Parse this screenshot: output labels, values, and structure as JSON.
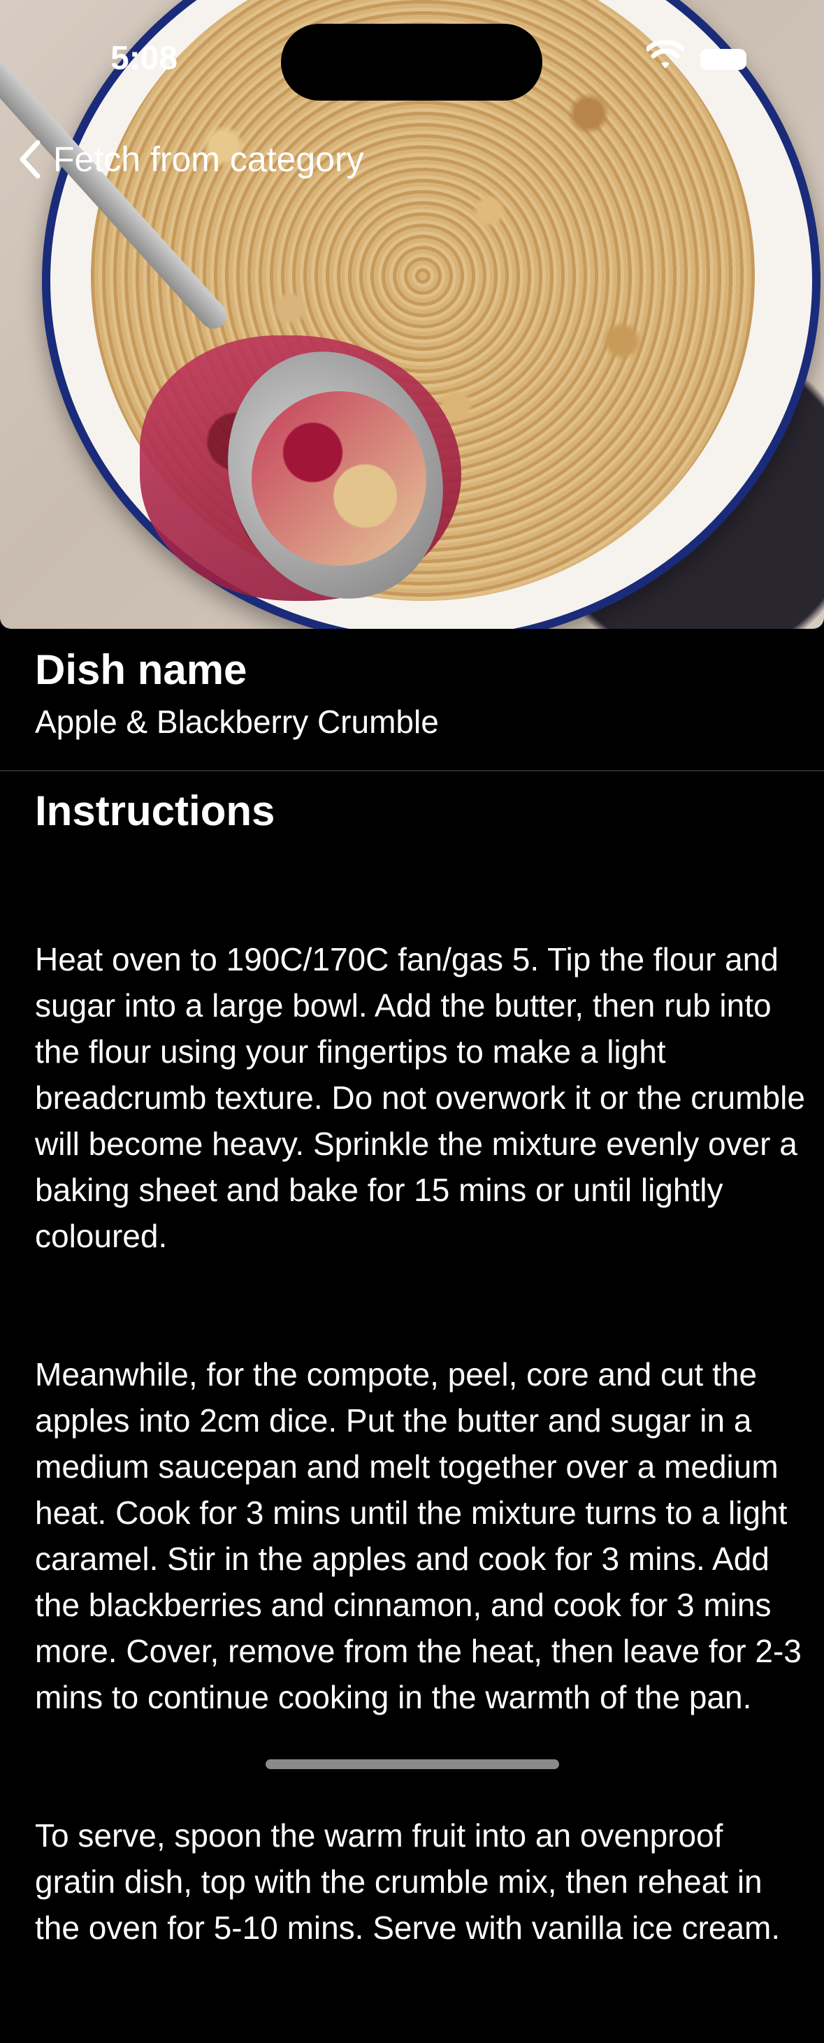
{
  "status_bar": {
    "time": "5:08",
    "wifi_icon": "wifi-icon",
    "battery_icon": "battery-icon"
  },
  "nav": {
    "back_icon": "chevron-left-icon",
    "back_label": "Fetch from category"
  },
  "hero_image": {
    "subject": "dish photo"
  },
  "dish": {
    "title": "Dish name",
    "name": "Apple & Blackberry Crumble"
  },
  "instructions": {
    "title": "Instructions",
    "paragraphs": [
      "Heat oven to 190C/170C fan/gas 5. Tip the flour and sugar into a large bowl. Add the butter, then rub into the flour using your fingertips to make a light breadcrumb texture. Do not overwork it or the crumble will become heavy. Sprinkle the mixture evenly over a baking sheet and bake for 15 mins or until lightly coloured.",
      "Meanwhile, for the compote, peel, core and cut the apples into 2cm dice. Put the butter and sugar in a medium saucepan and melt together over a medium heat. Cook for 3 mins until the mixture turns to a light caramel. Stir in the apples and cook for 3 mins. Add the blackberries and cinnamon, and cook for 3 mins more. Cover, remove from the heat, then leave for 2-3 mins to continue cooking in the warmth of the pan.",
      "To serve, spoon the warm fruit into an ovenproof gratin dish, top with the crumble mix, then reheat in the oven for 5-10 mins. Serve with vanilla ice cream."
    ]
  },
  "colors": {
    "background": "#000000",
    "text": "#ffffff",
    "divider": "#2e2e2e"
  }
}
